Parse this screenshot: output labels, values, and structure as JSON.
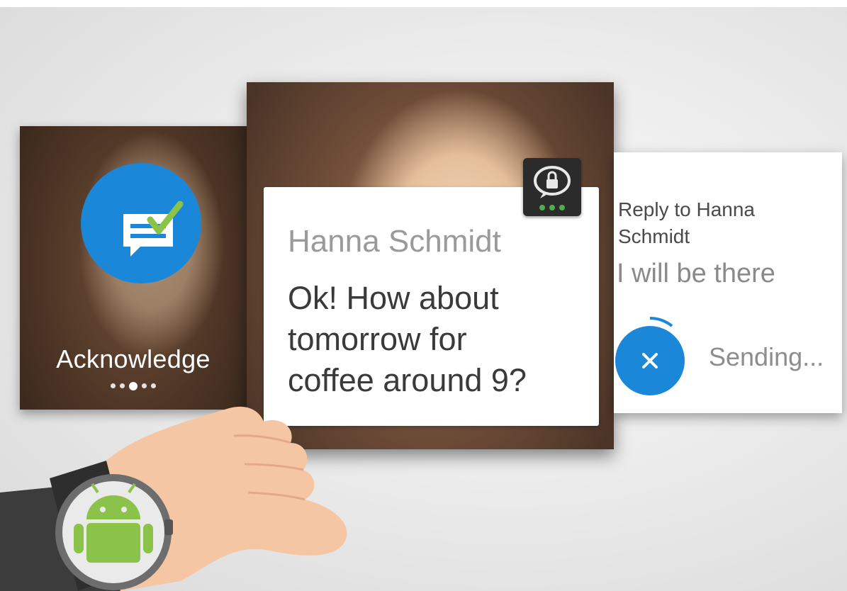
{
  "actions_card": {
    "action_label": "Acknowledge",
    "page_count": 5,
    "active_page": 3,
    "accent_color": "#1a87d8"
  },
  "notification_card": {
    "sender": "Hanna Schmidt",
    "message_lines": [
      "Ok! How about",
      "tomorrow for",
      "coffee around 9?"
    ],
    "app_icon": "lock-chat-app-icon"
  },
  "reply_card": {
    "title_lines": [
      "Reply to Hanna",
      "Schmidt"
    ],
    "reply_text": "I will be there",
    "status": "Sending...",
    "cancel_icon": "close-icon"
  },
  "wearer": {
    "watch_logo": "android-robot-icon"
  }
}
